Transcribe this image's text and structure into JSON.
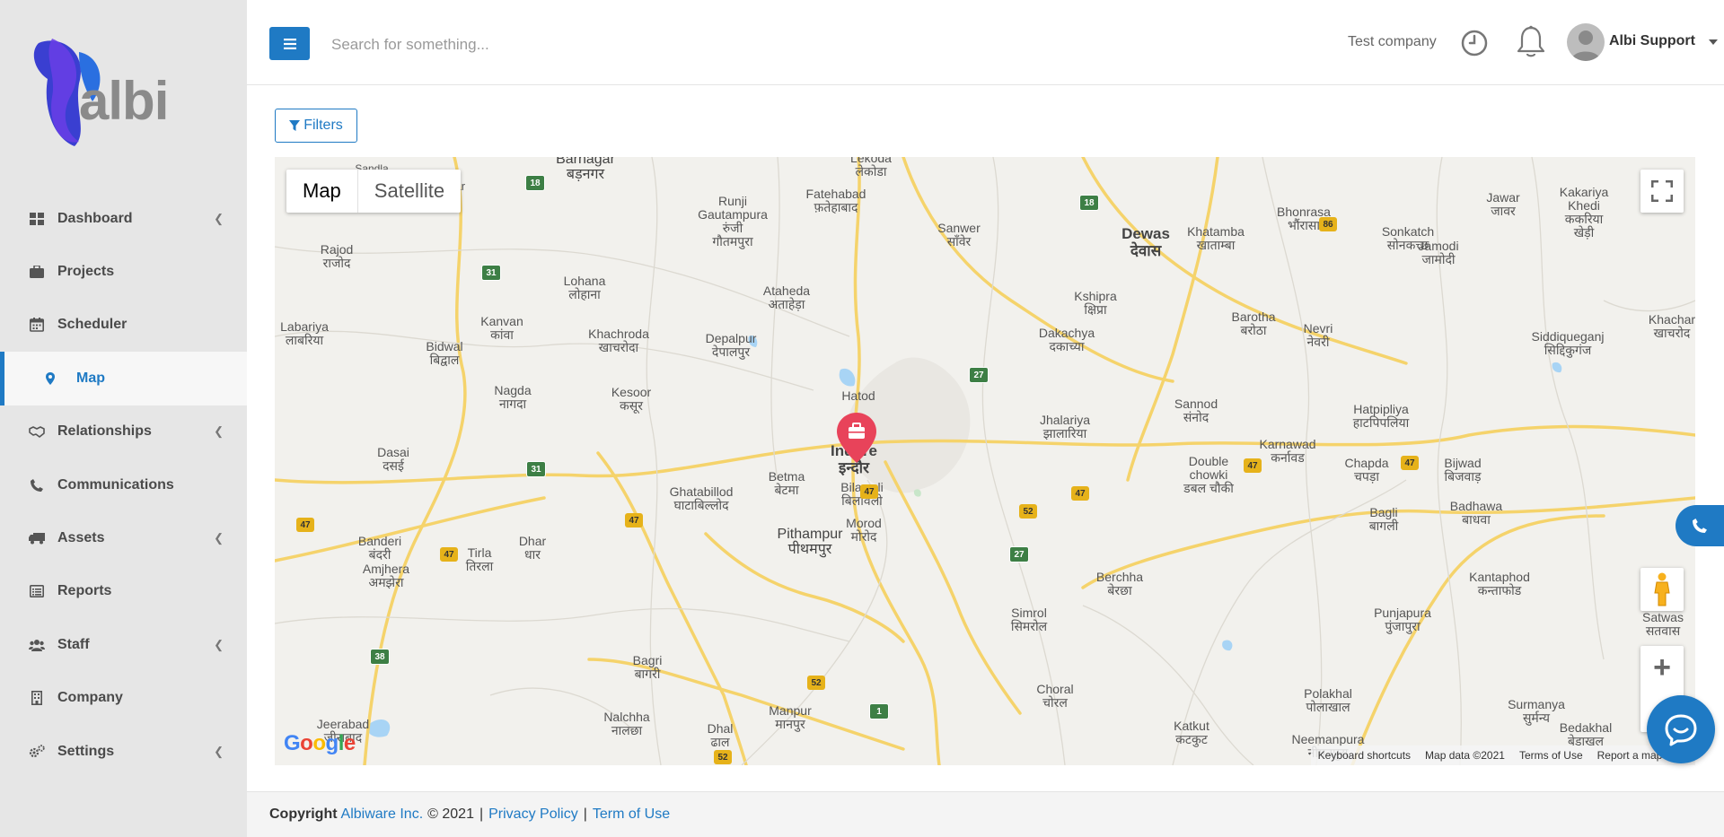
{
  "brand": {
    "logo_text": "albi"
  },
  "sidebar": {
    "items": [
      {
        "label": "Dashboard",
        "icon": "dashboard-icon",
        "has_submenu": true
      },
      {
        "label": "Projects",
        "icon": "briefcase-icon",
        "has_submenu": false
      },
      {
        "label": "Scheduler",
        "icon": "calendar-icon",
        "has_submenu": false
      },
      {
        "label": "Map",
        "icon": "map-marker-icon",
        "has_submenu": false,
        "active": true
      },
      {
        "label": "Relationships",
        "icon": "handshake-icon",
        "has_submenu": true
      },
      {
        "label": "Communications",
        "icon": "phone-icon",
        "has_submenu": false
      },
      {
        "label": "Assets",
        "icon": "truck-icon",
        "has_submenu": true
      },
      {
        "label": "Reports",
        "icon": "list-alt-icon",
        "has_submenu": false
      },
      {
        "label": "Staff",
        "icon": "users-icon",
        "has_submenu": true
      },
      {
        "label": "Company",
        "icon": "building-icon",
        "has_submenu": false
      },
      {
        "label": "Settings",
        "icon": "cogs-icon",
        "has_submenu": true
      }
    ]
  },
  "header": {
    "search_placeholder": "Search for something...",
    "company": "Test company",
    "user_name": "Albi Support"
  },
  "toolbar": {
    "filters_label": "Filters"
  },
  "map": {
    "type_map": "Map",
    "type_satellite": "Satellite",
    "logo": "Google",
    "attribution": {
      "shortcuts": "Keyboard shortcuts",
      "data": "Map data ©2021",
      "terms": "Terms of Use",
      "report": "Report a map error"
    },
    "marker_icon": "briefcase-marker-icon",
    "places": [
      {
        "name": "Barnagar\nबड़नगर",
        "kind": "city"
      },
      {
        "name": "Sandla",
        "kind": "small"
      },
      {
        "name": "awar",
        "kind": "small"
      },
      {
        "name": "Lekoda\nलेकोडा",
        "kind": "small"
      },
      {
        "name": "Runji\nGautampura\nरुंजी\nगौतमपुरा",
        "kind": "small"
      },
      {
        "name": "Fatehabad\nफ़तेहाबाद",
        "kind": "small"
      },
      {
        "name": "Sanwer\nसाँवेर",
        "kind": "small"
      },
      {
        "name": "Dewas\nदेवास",
        "kind": "big"
      },
      {
        "name": "Khatamba\nखाताम्बा",
        "kind": "small"
      },
      {
        "name": "Bhonrasa\nभौंरासा",
        "kind": "small"
      },
      {
        "name": "Sonkatch\nसोनकच्छ",
        "kind": "small"
      },
      {
        "name": "Jamodi\nजामोदी",
        "kind": "small"
      },
      {
        "name": "Jawar\nजावर",
        "kind": "small"
      },
      {
        "name": "Kakariya\nKhedi\nककरिया\nखेड़ी",
        "kind": "small"
      },
      {
        "name": "Rajod\nराजोद",
        "kind": "small"
      },
      {
        "name": "Lohana\nलोहाना",
        "kind": "small"
      },
      {
        "name": "Ataheda\nअताहेड़ा",
        "kind": "small"
      },
      {
        "name": "Kshipra\nक्षिप्रा",
        "kind": "small"
      },
      {
        "name": "Barotha\nबरोठा",
        "kind": "small"
      },
      {
        "name": "Nevri\nनेवरी",
        "kind": "small"
      },
      {
        "name": "Khachar\nखाचरोद",
        "kind": "small"
      },
      {
        "name": "Siddiqueganj\nसिद्दिकुगंज",
        "kind": "small"
      },
      {
        "name": "Labariya\nलाबरिया",
        "kind": "small"
      },
      {
        "name": "Kanvan\nकांवा",
        "kind": "small"
      },
      {
        "name": "Bidwal\nबिद्वाल",
        "kind": "small"
      },
      {
        "name": "Khachroda\nखाचरोदा",
        "kind": "small"
      },
      {
        "name": "Depalpur\nदेपालपुर",
        "kind": "small"
      },
      {
        "name": "Dakachya\nदकाच्या",
        "kind": "small"
      },
      {
        "name": "Hatod",
        "kind": "small"
      },
      {
        "name": "Nagda\nनागदा",
        "kind": "small"
      },
      {
        "name": "Kesoor\nकसूर",
        "kind": "small"
      },
      {
        "name": "Jhalariya\nझालारिया",
        "kind": "small"
      },
      {
        "name": "Sannod\nसंनोद",
        "kind": "small"
      },
      {
        "name": "Hatpipliya\nहाटपिपलिया",
        "kind": "small"
      },
      {
        "name": "Indore\nइन्दौर",
        "kind": "big"
      },
      {
        "name": "Dasai\nदसई",
        "kind": "small"
      },
      {
        "name": "Karnawad\nकर्नावड",
        "kind": "small"
      },
      {
        "name": "Double\nchowki\nडबल चौकी",
        "kind": "small"
      },
      {
        "name": "Chapda\nचपड़ा",
        "kind": "small"
      },
      {
        "name": "Bijwad\nबिजवाड़",
        "kind": "small"
      },
      {
        "name": "Betma\nबेटमा",
        "kind": "small"
      },
      {
        "name": "Bilawali\nबिलावली",
        "kind": "small"
      },
      {
        "name": "Ghatabillod\nघाटाबिल्लोद",
        "kind": "small"
      },
      {
        "name": "Badhawa\nबाधवा",
        "kind": "small"
      },
      {
        "name": "Bagli\nबागली",
        "kind": "small"
      },
      {
        "name": "Pithampur\nपीथमपुर",
        "kind": "city"
      },
      {
        "name": "Morod\nमोरोद",
        "kind": "small"
      },
      {
        "name": "Banderi\nबंदरी",
        "kind": "small"
      },
      {
        "name": "Dhar\nधार",
        "kind": "small"
      },
      {
        "name": "Tirla\nतिरला",
        "kind": "small"
      },
      {
        "name": "Amjhera\nअमझेरा",
        "kind": "small"
      },
      {
        "name": "Berchha\nबेरछा",
        "kind": "small"
      },
      {
        "name": "Kantaphod\nकन्ताफोड",
        "kind": "small"
      },
      {
        "name": "Simrol\nसिमरोल",
        "kind": "small"
      },
      {
        "name": "Punjapura\nपुंजापुरा",
        "kind": "small"
      },
      {
        "name": "Satwas\nसतवास",
        "kind": "small"
      },
      {
        "name": "Bagri\nबागरी",
        "kind": "small"
      },
      {
        "name": "Choral\nचोरल",
        "kind": "small"
      },
      {
        "name": "Polakhal\nपोलाखाल",
        "kind": "small"
      },
      {
        "name": "Surmanya\nसुर्मन्य",
        "kind": "small"
      },
      {
        "name": "Nalchha\nनालछा",
        "kind": "small"
      },
      {
        "name": "Manpur\nमानपुर",
        "kind": "small"
      },
      {
        "name": "Jeerabad\nजीराबाद",
        "kind": "small"
      },
      {
        "name": "Dhal\nढाल",
        "kind": "small"
      },
      {
        "name": "Katkut\nकटकुट",
        "kind": "small"
      },
      {
        "name": "Neemanpura\nनीमनपुरा",
        "kind": "small"
      },
      {
        "name": "Bedakhal\nबेडाखल",
        "kind": "small"
      }
    ],
    "shields": [
      {
        "num": "18",
        "kind": "green"
      },
      {
        "num": "18",
        "kind": "green"
      },
      {
        "num": "86",
        "kind": "yellow"
      },
      {
        "num": "31",
        "kind": "green"
      },
      {
        "num": "27",
        "kind": "green"
      },
      {
        "num": "31",
        "kind": "green"
      },
      {
        "num": "47",
        "kind": "yellow"
      },
      {
        "num": "47",
        "kind": "yellow"
      },
      {
        "num": "47",
        "kind": "yellow"
      },
      {
        "num": "47",
        "kind": "yellow"
      },
      {
        "num": "52",
        "kind": "yellow"
      },
      {
        "num": "47",
        "kind": "yellow"
      },
      {
        "num": "47",
        "kind": "yellow"
      },
      {
        "num": "47",
        "kind": "yellow"
      },
      {
        "num": "27",
        "kind": "green"
      },
      {
        "num": "38",
        "kind": "green"
      },
      {
        "num": "52",
        "kind": "yellow"
      },
      {
        "num": "1",
        "kind": "green"
      },
      {
        "num": "52",
        "kind": "yellow"
      }
    ]
  },
  "footer": {
    "copyright_label": "Copyright",
    "company_link": "Albiware Inc.",
    "year_text": "© 2021",
    "sep": "|",
    "privacy": "Privacy Policy",
    "terms": "Term of Use"
  }
}
